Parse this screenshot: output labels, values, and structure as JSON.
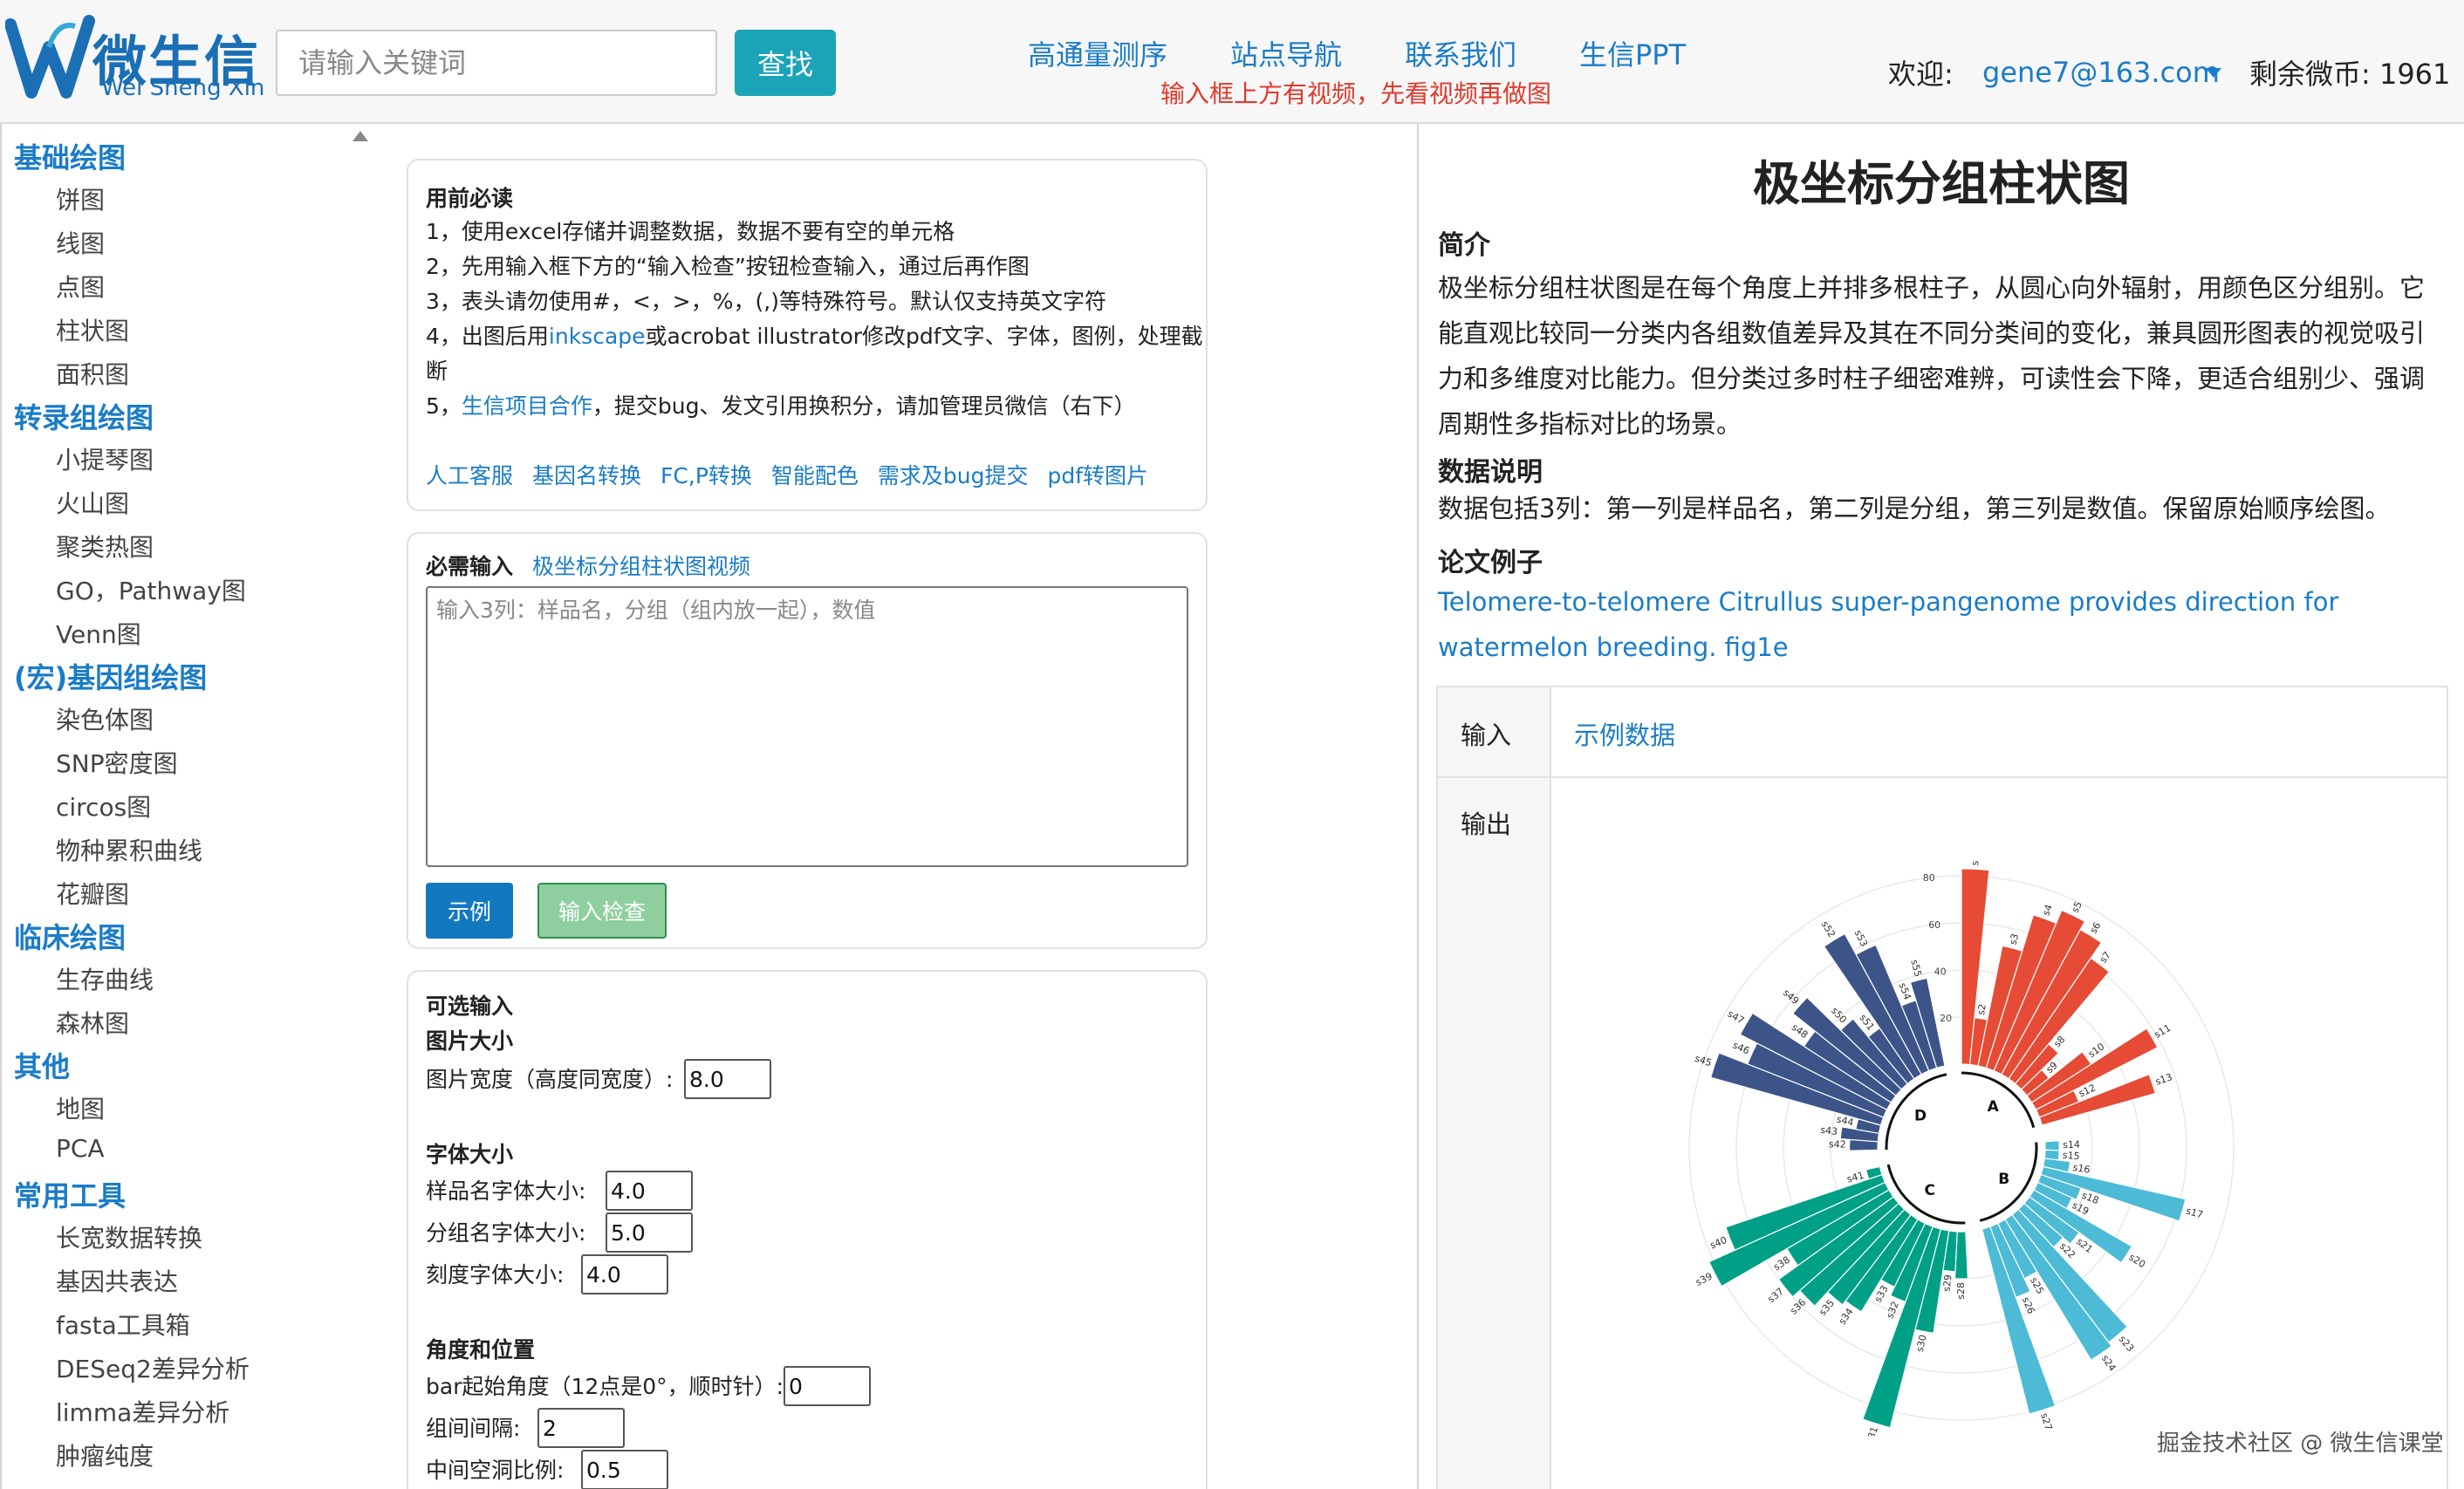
{
  "logo": {
    "title": "微生信",
    "subtitle": "Wei Sheng Xin"
  },
  "search": {
    "placeholder": "请输入关键词",
    "button": "查找"
  },
  "nav": {
    "links": [
      "高通量测序",
      "站点导航",
      "联系我们",
      "生信PPT"
    ],
    "notice": "输入框上方有视频，先看视频再做图"
  },
  "user": {
    "welcome": "欢迎:",
    "email": "gene7@163.com",
    "coins": "剩余微币: 1961"
  },
  "sidebar": [
    {
      "category": "基础绘图",
      "items": [
        "饼图",
        "线图",
        "点图",
        "柱状图",
        "面积图"
      ]
    },
    {
      "category": "转录组绘图",
      "items": [
        "小提琴图",
        "火山图",
        "聚类热图",
        "GO，Pathway图",
        "Venn图"
      ]
    },
    {
      "category": "(宏)基因组绘图",
      "items": [
        "染色体图",
        "SNP密度图",
        "circos图",
        "物种累积曲线",
        "花瓣图"
      ]
    },
    {
      "category": "临床绘图",
      "items": [
        "生存曲线",
        "森林图"
      ]
    },
    {
      "category": "其他",
      "items": [
        "地图",
        "PCA"
      ]
    },
    {
      "category": "常用工具",
      "items": [
        "长宽数据转换",
        "基因共表达",
        "fasta工具箱",
        "DESeq2差异分析",
        "limma差异分析",
        "肿瘤纯度"
      ]
    }
  ],
  "guide": {
    "title": "用前必读",
    "line1": "1，使用excel存储并调整数据，数据不要有空的单元格",
    "line2": "2，先用输入框下方的“输入检查”按钮检查输入，通过后再作图",
    "line3": "3，表头请勿使用#，<，>，%，(,)等特殊符号。默认仅支持英文字符",
    "line4a": "4，出图后用",
    "line4link": "inkscape",
    "line4b": "或acrobat illustrator修改pdf文字、字体，图例，处理截",
    "line4c": "断",
    "line5a": "5，",
    "line5link": "生信项目合作",
    "line5b": "，提交bug、发文引用换积分，请加管理员微信（右下）",
    "links": [
      "人工客服",
      "基因名转换",
      "FC,P转换",
      "智能配色",
      "需求及bug提交",
      "pdf转图片"
    ]
  },
  "required": {
    "title": "必需输入",
    "video_link": "极坐标分组柱状图视频",
    "placeholder": "输入3列：样品名，分组（组内放一起），数值",
    "example_button": "示例",
    "check_button": "输入检查"
  },
  "optional": {
    "title": "可选输入",
    "size_title": "图片大小",
    "width_label": "图片宽度（高度同宽度）:",
    "width_value": "8.0",
    "font_title": "字体大小",
    "sample_font_label": "样品名字体大小:",
    "sample_font_value": "4.0",
    "group_font_label": "分组名字体大小:",
    "group_font_value": "5.0",
    "tick_font_label": "刻度字体大小:",
    "tick_font_value": "4.0",
    "angle_title": "角度和位置",
    "start_angle_label": "bar起始角度（12点是0°，顺时针）:",
    "start_angle_value": "0",
    "gap_label": "组间间隔:",
    "gap_value": "2",
    "hole_label": "中间空洞比例:",
    "hole_value": "0.5"
  },
  "article": {
    "title": "极坐标分组柱状图",
    "intro_heading": "简介",
    "intro": "极坐标分组柱状图是在每个角度上并排多根柱子，从圆心向外辐射，用颜色区分组别。它能直观比较同一分类内各组数值差异及其在不同分类间的变化，兼具圆形图表的视觉吸引力和多维度对比能力。但分类过多时柱子细密难辨，可读性会下降，更适合组别少、强调周期性多指标对比的场景。",
    "data_heading": "数据说明",
    "data_desc": "数据包括3列：第一列是样品名，第二列是分组，第三列是数值。保留原始顺序绘图。",
    "paper_heading": "论文例子",
    "paper_link": "Telomere-to-telomere Citrullus super-pangenome provides direction for watermelon breeding. fig1e",
    "input_label": "输入",
    "example_link": "示例数据",
    "output_label": "输出"
  },
  "chart_data": {
    "type": "bar",
    "polar": true,
    "ylim": [
      0,
      80
    ],
    "yticks": [
      20,
      40,
      60,
      80
    ],
    "group_order": [
      "A",
      "B",
      "C",
      "D"
    ],
    "group_colors": {
      "A": "#e64b35",
      "B": "#4dbbd5",
      "C": "#00a087",
      "D": "#3c5488"
    },
    "samples": [
      "s1",
      "s2",
      "s3",
      "s4",
      "s5",
      "s6",
      "s7",
      "s8",
      "s9",
      "s10",
      "s11",
      "s12",
      "s13",
      "s14",
      "s15",
      "s16",
      "s17",
      "s18",
      "s19",
      "s20",
      "s21",
      "s22",
      "s23",
      "s24",
      "s25",
      "s26",
      "s27",
      "s28",
      "s29",
      "s30",
      "s31",
      "s32",
      "s33",
      "s34",
      "s35",
      "s36",
      "s37",
      "s38",
      "s39",
      "s40",
      "s41",
      "s42",
      "s43",
      "s44",
      "s45",
      "s46",
      "s47",
      "s48",
      "s49",
      "s50",
      "s51",
      "s52",
      "s53",
      "s54",
      "s55"
    ],
    "groups": [
      "A",
      "A",
      "A",
      "A",
      "A",
      "A",
      "A",
      "A",
      "A",
      "A",
      "A",
      "A",
      "A",
      "B",
      "B",
      "B",
      "B",
      "B",
      "B",
      "B",
      "B",
      "B",
      "B",
      "B",
      "B",
      "B",
      "B",
      "C",
      "C",
      "C",
      "C",
      "C",
      "C",
      "C",
      "C",
      "C",
      "C",
      "C",
      "C",
      "C",
      "C",
      "D",
      "D",
      "D",
      "D",
      "D",
      "D",
      "D",
      "D",
      "D",
      "D",
      "D",
      "D",
      "D",
      "D"
    ],
    "values": [
      83,
      20,
      52,
      68,
      74,
      70,
      62,
      22,
      12,
      30,
      58,
      18,
      50,
      6,
      6,
      11,
      62,
      18,
      16,
      48,
      26,
      22,
      68,
      70,
      26,
      32,
      81,
      20,
      17,
      44,
      87,
      34,
      30,
      46,
      48,
      56,
      60,
      50,
      82,
      70,
      6,
      12,
      16,
      10,
      75,
      62,
      70,
      44,
      56,
      36,
      26,
      68,
      58,
      30,
      38
    ]
  },
  "watermark": "掘金技术社区 @ 微生信课堂"
}
